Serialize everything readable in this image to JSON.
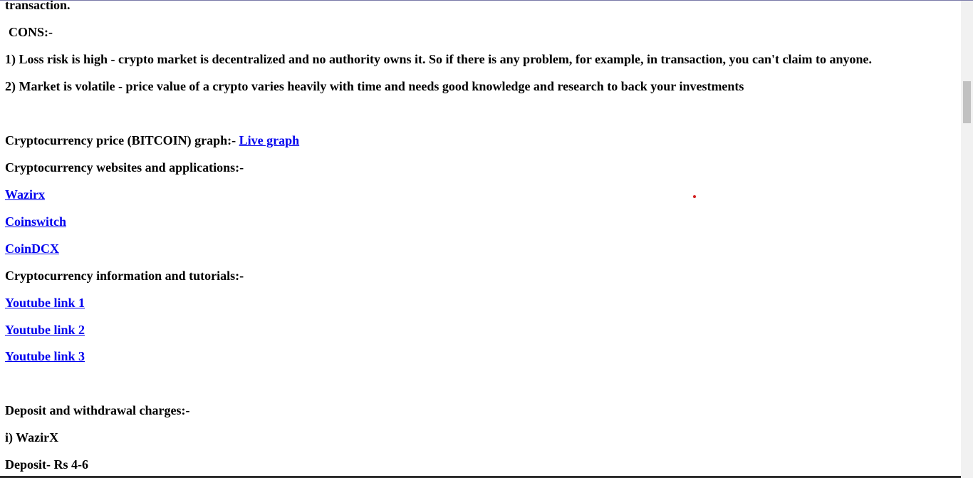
{
  "content": {
    "transaction_tail": "transaction.",
    "cons_heading": "CONS:-",
    "con_1": "1) Loss risk is high - crypto market is decentralized and no authority owns it. So if there is any problem, for example, in transaction, you can't claim to anyone.",
    "con_2": "2) Market is volatile - price value of a crypto varies heavily with time and needs good knowledge and research to back your investments",
    "price_graph_label": "Cryptocurrency price (BITCOIN) graph:- ",
    "live_graph_link": "Live graph",
    "websites_heading": "Cryptocurrency websites and applications:-",
    "websites": [
      "Wazirx",
      "Coinswitch",
      "CoinDCX"
    ],
    "tutorials_heading": "Cryptocurrency information and tutorials:-",
    "tutorials": [
      "Youtube link 1",
      "Youtube link 2",
      "Youtube link 3"
    ],
    "charges_heading": "Deposit and withdrawal charges:-",
    "charges_exchange": "i) WazirX",
    "charges_deposit": "Deposit- Rs 4-6"
  }
}
